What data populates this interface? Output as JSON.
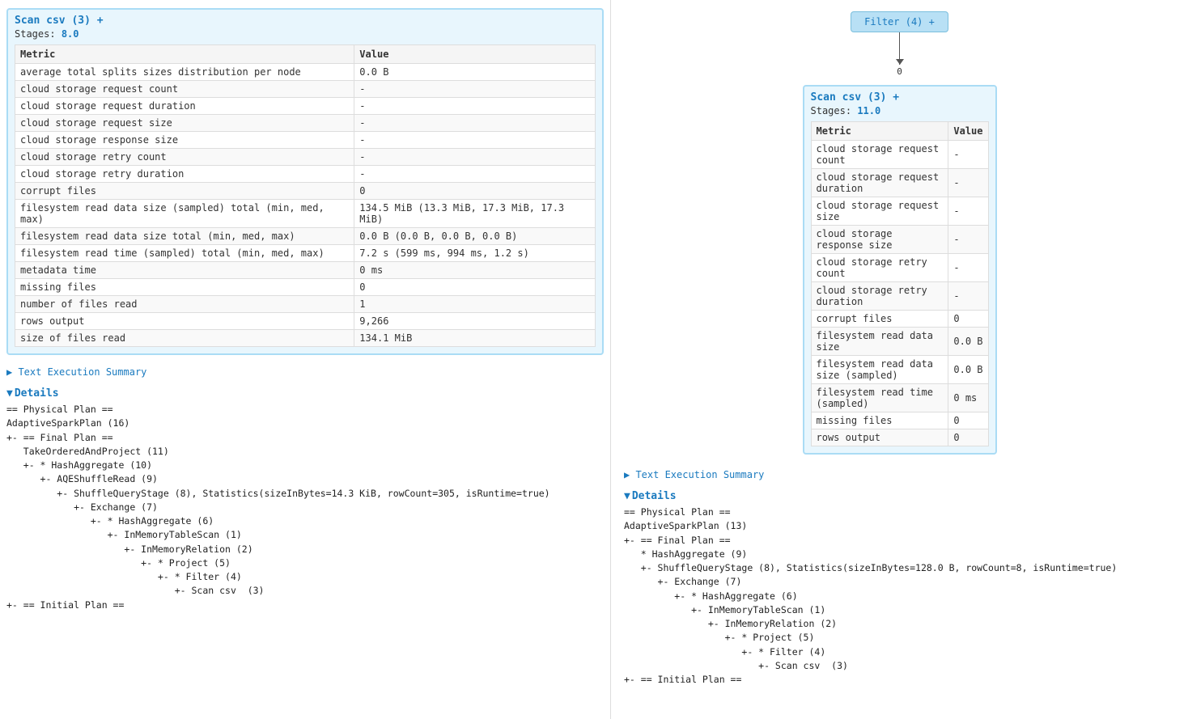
{
  "left": {
    "scanCard": {
      "title": "Scan csv (3)",
      "titlePlus": "+",
      "stages_label": "Stages:",
      "stages_value": "8.0",
      "metrics": {
        "headers": [
          "Metric",
          "Value"
        ],
        "rows": [
          [
            "average total splits sizes distribution per node",
            "0.0 B"
          ],
          [
            "cloud storage request count",
            "-"
          ],
          [
            "cloud storage request duration",
            "-"
          ],
          [
            "cloud storage request size",
            "-"
          ],
          [
            "cloud storage response size",
            "-"
          ],
          [
            "cloud storage retry count",
            "-"
          ],
          [
            "cloud storage retry duration",
            "-"
          ],
          [
            "corrupt files",
            "0"
          ],
          [
            "filesystem read data size (sampled) total (min, med, max)",
            "134.5 MiB (13.3 MiB, 17.3 MiB, 17.3 MiB)"
          ],
          [
            "filesystem read data size total (min, med, max)",
            "0.0 B (0.0 B, 0.0 B, 0.0 B)"
          ],
          [
            "filesystem read time (sampled) total (min, med, max)",
            "7.2 s (599 ms, 994 ms, 1.2 s)"
          ],
          [
            "metadata time",
            "0 ms"
          ],
          [
            "missing files",
            "0"
          ],
          [
            "number of files read",
            "1"
          ],
          [
            "rows output",
            "9,266"
          ],
          [
            "size of files read",
            "134.1 MiB"
          ]
        ]
      }
    },
    "textExecSummary": "Text Execution Summary",
    "details": {
      "label": "Details",
      "code": "== Physical Plan ==\nAdaptiveSparkPlan (16)\n+- == Final Plan ==\n   TakeOrderedAndProject (11)\n   +- * HashAggregate (10)\n      +- AQEShuffleRead (9)\n         +- ShuffleQueryStage (8), Statistics(sizeInBytes=14.3 KiB, rowCount=305, isRuntime=true)\n            +- Exchange (7)\n               +- * HashAggregate (6)\n                  +- InMemoryTableScan (1)\n                     +- InMemoryRelation (2)\n                        +- * Project (5)\n                           +- * Filter (4)\n                              +- Scan csv  (3)\n+- == Initial Plan =="
    }
  },
  "right": {
    "filterNode": {
      "label": "Filter (4)",
      "plus": "+"
    },
    "arrowLabel": "0",
    "scanCard": {
      "title": "Scan csv (3)",
      "titlePlus": "+",
      "stages_label": "Stages:",
      "stages_value": "11.0",
      "metrics": {
        "headers": [
          "Metric",
          "Value"
        ],
        "rows": [
          [
            "cloud storage request count",
            "-"
          ],
          [
            "cloud storage request duration",
            "-"
          ],
          [
            "cloud storage request size",
            "-"
          ],
          [
            "cloud storage response size",
            "-"
          ],
          [
            "cloud storage retry count",
            "-"
          ],
          [
            "cloud storage retry duration",
            "-"
          ],
          [
            "corrupt files",
            "0"
          ],
          [
            "filesystem read data size",
            "0.0 B"
          ],
          [
            "filesystem read data size (sampled)",
            "0.0 B"
          ],
          [
            "filesystem read time (sampled)",
            "0 ms"
          ],
          [
            "missing files",
            "0"
          ],
          [
            "rows output",
            "0"
          ]
        ]
      }
    },
    "textExecSummary": "Text Execution Summary",
    "details": {
      "label": "Details",
      "code": "== Physical Plan ==\nAdaptiveSparkPlan (13)\n+- == Final Plan ==\n   * HashAggregate (9)\n   +- ShuffleQueryStage (8), Statistics(sizeInBytes=128.0 B, rowCount=8, isRuntime=true)\n      +- Exchange (7)\n         +- * HashAggregate (6)\n            +- InMemoryTableScan (1)\n               +- InMemoryRelation (2)\n                  +- * Project (5)\n                     +- * Filter (4)\n                        +- Scan csv  (3)\n+- == Initial Plan =="
    }
  }
}
